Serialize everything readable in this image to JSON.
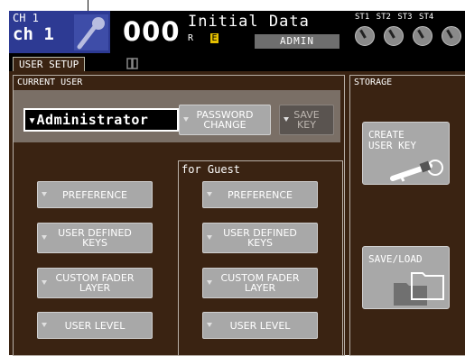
{
  "header": {
    "channel_number": "CH 1",
    "channel_name": "ch 1",
    "scene_number": "000",
    "scene_title": "Initial Data",
    "scene_flags": "R",
    "scene_edit_flag": "E",
    "current_user": "ADMIN",
    "stereo_labels": "ST1 ST2 ST3 ST4"
  },
  "tabs": [
    {
      "label": "USER SETUP"
    }
  ],
  "current_user_section": {
    "label": "CURRENT USER",
    "selected_user": "Administrator",
    "password_change_line1": "PASSWORD",
    "password_change_line2": "CHANGE",
    "save_key_line1": "SAVE",
    "save_key_line2": "KEY"
  },
  "user_buttons": {
    "preference": "PREFERENCE",
    "user_defined_keys_line1": "USER DEFINED",
    "user_defined_keys_line2": "KEYS",
    "custom_fader_layer_line1": "CUSTOM FADER",
    "custom_fader_layer_line2": "LAYER",
    "user_level": "USER LEVEL"
  },
  "guest_section": {
    "label": "for Guest",
    "preference": "PREFERENCE",
    "user_defined_keys_line1": "USER DEFINED",
    "user_defined_keys_line2": "KEYS",
    "custom_fader_layer_line1": "CUSTOM FADER",
    "custom_fader_layer_line2": "LAYER",
    "user_level": "USER LEVEL"
  },
  "storage": {
    "label": "STORAGE",
    "create_user_key_line1": "CREATE",
    "create_user_key_line2": "USER KEY",
    "save_load": "SAVE/LOAD"
  },
  "icons": {
    "mic": "microphone-icon",
    "key": "key-icon",
    "folder": "folder-icon",
    "book": "book-icon",
    "dropdown": "triangle-down-icon",
    "knob": "rotary-knob-icon"
  },
  "colors": {
    "channel_box": "#2d3a93",
    "panel_bg": "#3a2312",
    "button": "#a8a8a8",
    "edit_flag": "#e6c000"
  }
}
